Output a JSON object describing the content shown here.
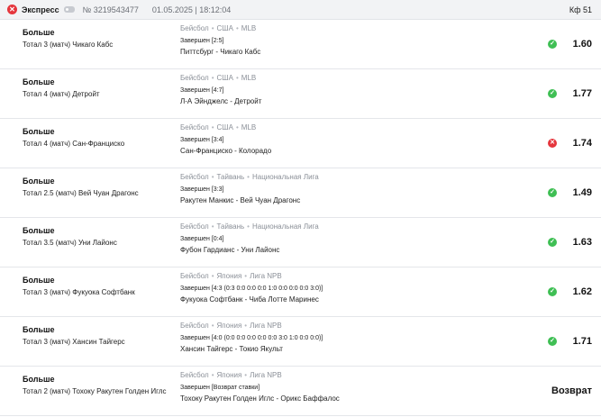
{
  "header": {
    "status_icon": "✕",
    "title": "Экспресс",
    "bet_number": "№ 3219543477",
    "datetime": "01.05.2025 | 18:12:04",
    "coefficient": "Кф 51"
  },
  "colors": {
    "win": "#3fbf54",
    "lose": "#e5363d"
  },
  "bets": [
    {
      "direction": "Больше",
      "market": "Тотал 3 (матч) Чикаго Кабс",
      "sport": "Бейсбол",
      "country": "США",
      "league": "MLB",
      "status": "Завершен [2:5]",
      "teams": "Питтсбург - Чикаго Кабс",
      "result": "win",
      "result_icon": "✓",
      "odds": "1.60"
    },
    {
      "direction": "Больше",
      "market": "Тотал 4 (матч) Детройт",
      "sport": "Бейсбол",
      "country": "США",
      "league": "MLB",
      "status": "Завершен [4:7]",
      "teams": "Л-А Эйнджелс - Детройт",
      "result": "win",
      "result_icon": "✓",
      "odds": "1.77"
    },
    {
      "direction": "Больше",
      "market": "Тотал 4 (матч) Сан-Франциско",
      "sport": "Бейсбол",
      "country": "США",
      "league": "MLB",
      "status": "Завершен [3:4]",
      "teams": "Сан-Франциско - Колорадо",
      "result": "lose",
      "result_icon": "✕",
      "odds": "1.74"
    },
    {
      "direction": "Больше",
      "market": "Тотал 2.5 (матч) Вей Чуан Драгонс",
      "sport": "Бейсбол",
      "country": "Тайвань",
      "league": "Национальная Лига",
      "status": "Завершен [3:3]",
      "teams": "Ракутен Манкис - Вей Чуан Драгонс",
      "result": "win",
      "result_icon": "✓",
      "odds": "1.49"
    },
    {
      "direction": "Больше",
      "market": "Тотал 3.5 (матч) Уни Лайонс",
      "sport": "Бейсбол",
      "country": "Тайвань",
      "league": "Национальная Лига",
      "status": "Завершен [0:4]",
      "teams": "Фубон Гардианс - Уни Лайонс",
      "result": "win",
      "result_icon": "✓",
      "odds": "1.63"
    },
    {
      "direction": "Больше",
      "market": "Тотал 3 (матч) Фукуока Софтбанк",
      "sport": "Бейсбол",
      "country": "Япония",
      "league": "Лига NPB",
      "status": "Завершен [4:3 (0:3 0:0 0:0 0:0 1:0 0:0 0:0 0:0 3:0)]",
      "teams": "Фукуока Софтбанк - Чиба Лотте Маринес",
      "result": "win",
      "result_icon": "✓",
      "odds": "1.62"
    },
    {
      "direction": "Больше",
      "market": "Тотал 3 (матч) Хансин Тайгерс",
      "sport": "Бейсбол",
      "country": "Япония",
      "league": "Лига NPB",
      "status": "Завершен [4:0 (0:0 0:0 0:0 0:0 0:0 3:0 1:0 0:0 0:0)]",
      "teams": "Хансин Тайгерс - Токио Якульт",
      "result": "win",
      "result_icon": "✓",
      "odds": "1.71"
    },
    {
      "direction": "Больше",
      "market": "Тотал 2 (матч) Тохоку Ракутен Голден Иглс",
      "sport": "Бейсбол",
      "country": "Япония",
      "league": "Лига NPB",
      "status": "Завершен [Возврат ставки]",
      "teams": "Тохоку Ракутен Голден Иглс - Орикс Баффалос",
      "result": "return",
      "result_text": "Возврат"
    }
  ]
}
